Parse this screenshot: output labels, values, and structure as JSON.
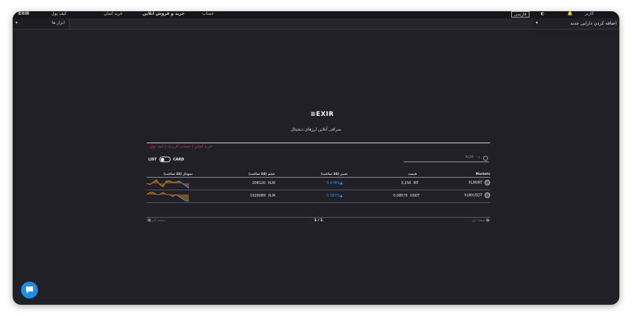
{
  "topbar": {
    "brand": "EXIR",
    "wallet": "کیف پول",
    "quick_buy": "خرید آسان",
    "title": "خرید و فروش آنلاین",
    "account": "حساب",
    "language": "فارسی",
    "username": "کاربر"
  },
  "secbar": {
    "tools": "ابزار ها",
    "add_asset": "اضافه کردن دارایی جدید"
  },
  "logo": {
    "text": "EXIR"
  },
  "tagline": "صرافی آنلاین ارزهای دیجیتال",
  "tabs": [
    "خرید آسان",
    "حساب کاربری",
    "کیف پول"
  ],
  "search": {
    "placeholder": "XLM"
  },
  "view_toggle": {
    "list": "LIST",
    "card": "CARD"
  },
  "table": {
    "headers": {
      "markets": "Markets",
      "price": "قیمت",
      "change": "تغییر (24 ساعت)",
      "volume": "حجم (24 ساعت)",
      "chart": "نمودار (24 ساعت)"
    },
    "rows": [
      {
        "market": "XLM/IRT",
        "price": "3,156",
        "price_unit": "IRT",
        "change": "0.478%",
        "volume": "208120",
        "volume_unit": "XLM"
      },
      {
        "market": "XLM/USDT",
        "price": "0.08575",
        "price_unit": "USDT",
        "change": "0.587%",
        "volume": "1929089",
        "volume_unit": "XLM"
      }
    ]
  },
  "pager": {
    "page": "1 / 1",
    "first": "صفحه اول",
    "last": "صفحه آخر"
  },
  "colors": {
    "accent": "#e0325a",
    "positive": "#1e9bff",
    "spark_fill": "#c8781e",
    "chat": "#1c8fe8"
  },
  "chart_data": [
    {
      "type": "area",
      "values": [
        6,
        5,
        7,
        9,
        5,
        3,
        8,
        8,
        7,
        7,
        8,
        6,
        4,
        2
      ]
    },
    {
      "type": "area",
      "values": [
        5,
        6,
        6,
        5,
        5,
        6,
        5,
        5,
        4,
        5,
        4,
        3,
        2,
        2
      ]
    }
  ]
}
